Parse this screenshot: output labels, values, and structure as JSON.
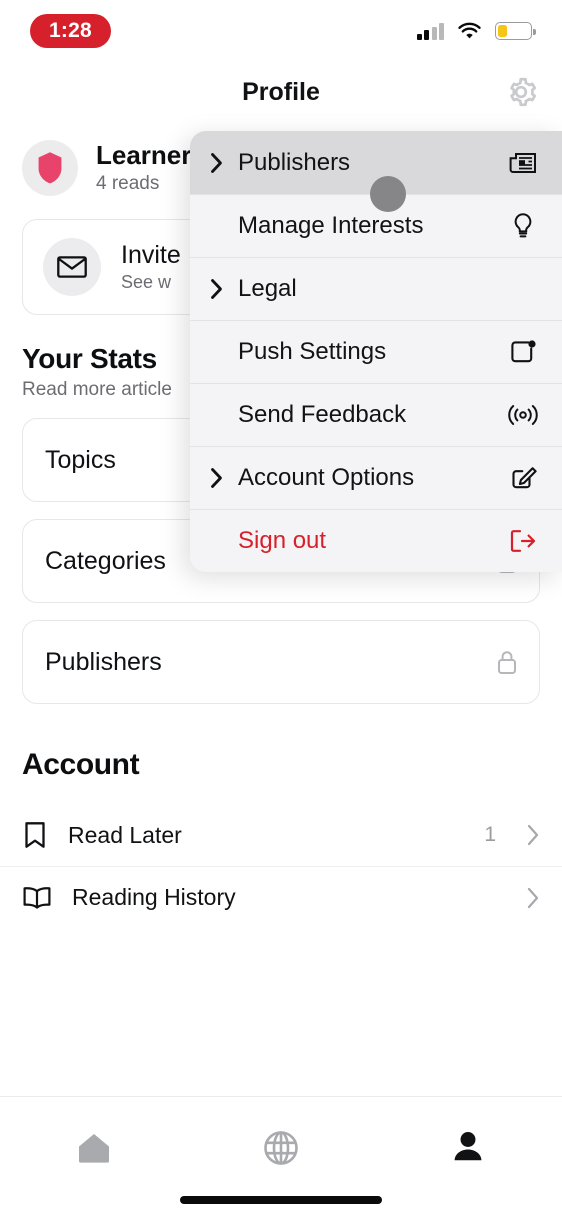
{
  "status_bar": {
    "time": "1:28",
    "time_pill_color": "#d6212c",
    "signal_icon": "cellular-signal-icon",
    "wifi_icon": "wifi-icon",
    "battery_icon": "battery-low-power-icon",
    "battery_fill_color": "#f5c518",
    "battery_level_percent": 30
  },
  "header": {
    "title": "Profile",
    "settings_icon": "gear-icon"
  },
  "profile": {
    "avatar_icon": "shield-badge-icon",
    "avatar_color": "#e8436a",
    "name": "Learner",
    "reads": "4 reads"
  },
  "invite_card": {
    "icon": "envelope-icon",
    "title": "Invite",
    "subtitle": "See w"
  },
  "stats_section": {
    "title": "Your Stats",
    "subtitle": "Read more article",
    "cards": [
      {
        "label": "Topics",
        "icon": null
      },
      {
        "label": "Categories",
        "icon": "lock-icon"
      },
      {
        "label": "Publishers",
        "icon": "lock-icon"
      }
    ]
  },
  "account_section": {
    "title": "Account",
    "rows": [
      {
        "label": "Read Later",
        "icon": "bookmark-icon",
        "count": "1",
        "chevron": "chevron-right-icon"
      },
      {
        "label": "Reading History",
        "icon": "open-book-icon",
        "count": "",
        "chevron": "chevron-right-icon"
      }
    ]
  },
  "dropdown_menu": {
    "items": [
      {
        "label": "Publishers",
        "icon": "newspaper-icon",
        "has_submenu_arrow": true,
        "highlighted": true,
        "danger": false
      },
      {
        "label": "Manage Interests",
        "icon": "lightbulb-icon",
        "has_submenu_arrow": false,
        "highlighted": false,
        "danger": false
      },
      {
        "label": "Legal",
        "icon": null,
        "has_submenu_arrow": true,
        "highlighted": false,
        "danger": false
      },
      {
        "label": "Push Settings",
        "icon": "push-notification-icon",
        "has_submenu_arrow": false,
        "highlighted": false,
        "danger": false
      },
      {
        "label": "Send Feedback",
        "icon": "broadcast-icon",
        "has_submenu_arrow": false,
        "highlighted": false,
        "danger": false
      },
      {
        "label": "Account Options",
        "icon": "edit-square-icon",
        "has_submenu_arrow": true,
        "highlighted": false,
        "danger": false
      },
      {
        "label": "Sign out",
        "icon": "sign-out-icon",
        "has_submenu_arrow": false,
        "highlighted": false,
        "danger": true
      }
    ],
    "danger_color": "#d6212c",
    "highlight_color": "#d9d9db"
  },
  "cursor": {
    "icon": "cursor-dot",
    "color": "#868688"
  },
  "tab_bar": {
    "tabs": [
      {
        "name": "home",
        "icon": "home-icon",
        "active": false
      },
      {
        "name": "discover",
        "icon": "globe-icon",
        "active": false
      },
      {
        "name": "profile",
        "icon": "person-icon",
        "active": true
      }
    ],
    "active_color": "#111214",
    "inactive_color": "#a9aaad"
  }
}
